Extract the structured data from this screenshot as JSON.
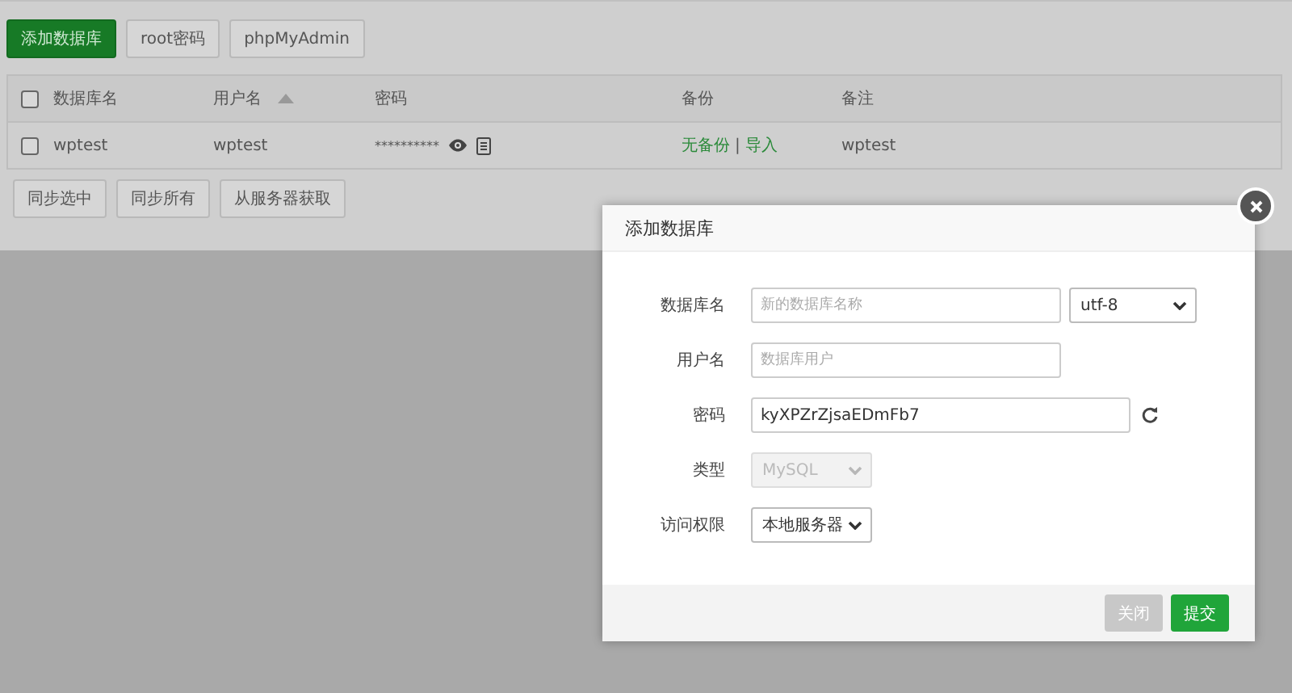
{
  "toolbar": {
    "buttons": [
      {
        "label": "添加数据库",
        "kind": "primary"
      },
      {
        "label": "root密码",
        "kind": "default"
      },
      {
        "label": "phpMyAdmin",
        "kind": "default"
      }
    ]
  },
  "table": {
    "header_checked": false,
    "columns": [
      {
        "label": "数据库名",
        "sorted": false
      },
      {
        "label": "用户名",
        "sorted": true
      },
      {
        "label": "密码",
        "sorted": false
      },
      {
        "label": "备份",
        "sorted": false
      },
      {
        "label": "备注",
        "sorted": false
      }
    ],
    "rows": [
      {
        "checked": false,
        "database": "wptest",
        "user": "wptest",
        "password": "**********",
        "backup": "无备份",
        "separator": "|",
        "import": "导入",
        "note": "wptest"
      }
    ]
  },
  "bulk_buttons": [
    "同步选中",
    "同步所有",
    "从服务器获取"
  ],
  "dialog": {
    "title": "添加数据库",
    "fields": [
      {
        "label": "数据库名",
        "kind": "text",
        "placeholder": "新的数据库名称",
        "select": {
          "value": "utf-8"
        }
      },
      {
        "label": "用户名",
        "kind": "text",
        "placeholder": "数据库用户"
      },
      {
        "label": "密码",
        "kind": "password",
        "value": "kyXPZrZjsaEDmFb7"
      },
      {
        "label": "类型",
        "kind": "select",
        "value": "MySQL",
        "disabled": true
      },
      {
        "label": "访问权限",
        "kind": "select",
        "value": "本地服务器",
        "disabled": false
      }
    ],
    "buttons": [
      {
        "label": "关闭",
        "kind": "secondary"
      },
      {
        "label": "提交",
        "kind": "primary"
      }
    ]
  }
}
